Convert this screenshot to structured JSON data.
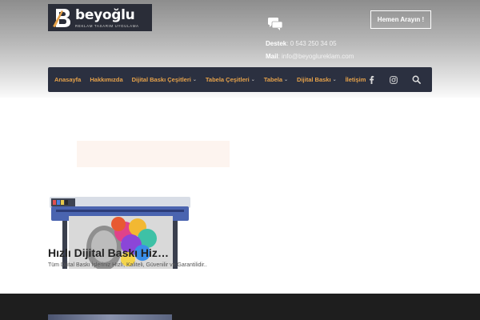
{
  "brand": {
    "name": "beyoğlu",
    "tagline": "REKLAM TASARIM UYGULAMA",
    "colors": {
      "nav_bg": "#2b3040",
      "accent": "#e6a24a",
      "footer": "#1e1e1e"
    }
  },
  "contact": {
    "support_label": "Destek",
    "support_value": ": 0 543 250 34 05",
    "mail_label": "Mail",
    "mail_value": ": info@beyoglureklam.com",
    "icon": "chat-bubbles-icon"
  },
  "header": {
    "call_button": "Hemen Arayın !"
  },
  "nav": {
    "items": [
      {
        "label": "Anasayfa",
        "dropdown": false
      },
      {
        "label": "Hakkımızda",
        "dropdown": false
      },
      {
        "label": "Dijital Baskı Çeşitleri",
        "dropdown": true
      },
      {
        "label": "Tabela Çeşitleri",
        "dropdown": true
      },
      {
        "label": "Tabela",
        "dropdown": true
      },
      {
        "label": "Dijital Baskı",
        "dropdown": true
      },
      {
        "label": "İletişim",
        "dropdown": false
      }
    ],
    "icons": [
      "facebook-icon",
      "instagram-icon",
      "search-icon"
    ]
  },
  "card": {
    "title": "Hızlı Dijital Baskı Hizmetleri",
    "description": "Tüm Dijital Baskı İşleriniz Hızlı, Kaliteli, Güvenilir ve Garantilidir..",
    "image": "large-format-printer-image"
  }
}
